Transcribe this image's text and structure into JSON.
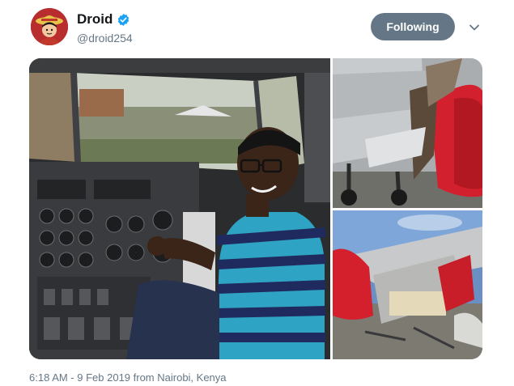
{
  "author": {
    "display_name": "Droid",
    "handle": "@droid254",
    "avatar_icon": "straw-hat-character-avatar",
    "verified": true
  },
  "actions": {
    "follow_label": "Following",
    "more_icon": "chevron-down-icon"
  },
  "media": {
    "count": 3,
    "images": [
      {
        "name": "photo-cockpit",
        "subject": "person seated in aircraft cockpit"
      },
      {
        "name": "photo-engine-damage",
        "subject": "damaged red aircraft engine nacelle"
      },
      {
        "name": "photo-collision-wreckage",
        "subject": "collided aircraft wing and engine wreckage"
      }
    ]
  },
  "meta": {
    "timestamp": "6:18 AM - 9 Feb 2019 from Nairobi, Kenya"
  },
  "colors": {
    "follow_button_bg": "#657786",
    "verified_blue": "#1da1f2",
    "secondary_text": "#657786"
  }
}
